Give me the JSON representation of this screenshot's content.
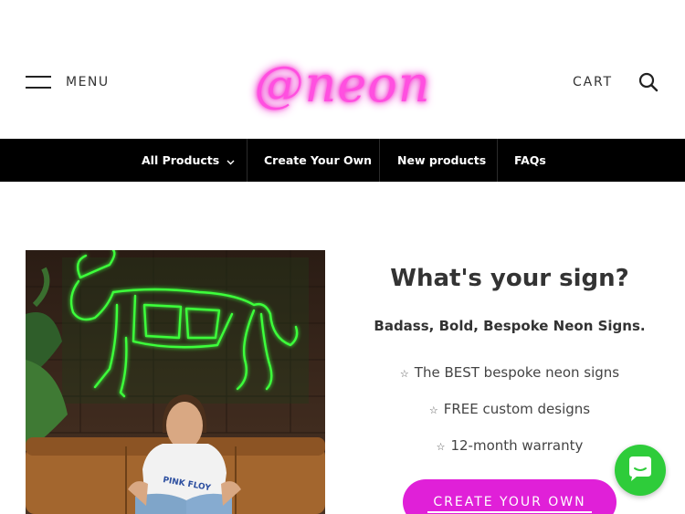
{
  "header": {
    "menu_label": "MENU",
    "logo_text": "@neon",
    "cart_label": "CART"
  },
  "nav": {
    "items": [
      {
        "label": "All Products",
        "has_dropdown": true
      },
      {
        "label": "Create Your Own"
      },
      {
        "label": "New products"
      },
      {
        "label": "FAQs"
      }
    ]
  },
  "promo": {
    "title": "What's your sign?",
    "subtitle": "Badass, Bold, Bespoke Neon Signs.",
    "features": [
      "The BEST bespoke neon signs",
      "FREE custom designs",
      "12-month warranty"
    ],
    "cta_label": "CREATE YOUR OWN"
  },
  "hero_image": {
    "shirt_text": "PINK FLOY"
  },
  "colors": {
    "logo_pink": "#ff4fe0",
    "cta_magenta": "#e020d8",
    "navbar_bg": "#000000",
    "chat_green": "#2ecc3a",
    "neon_green": "#39ff3a"
  },
  "icons": {
    "menu": "hamburger-icon",
    "search": "search-icon",
    "dropdown": "chevron-down-icon",
    "chat": "chat-bubble-icon",
    "feature_bullet": "star-icon"
  }
}
